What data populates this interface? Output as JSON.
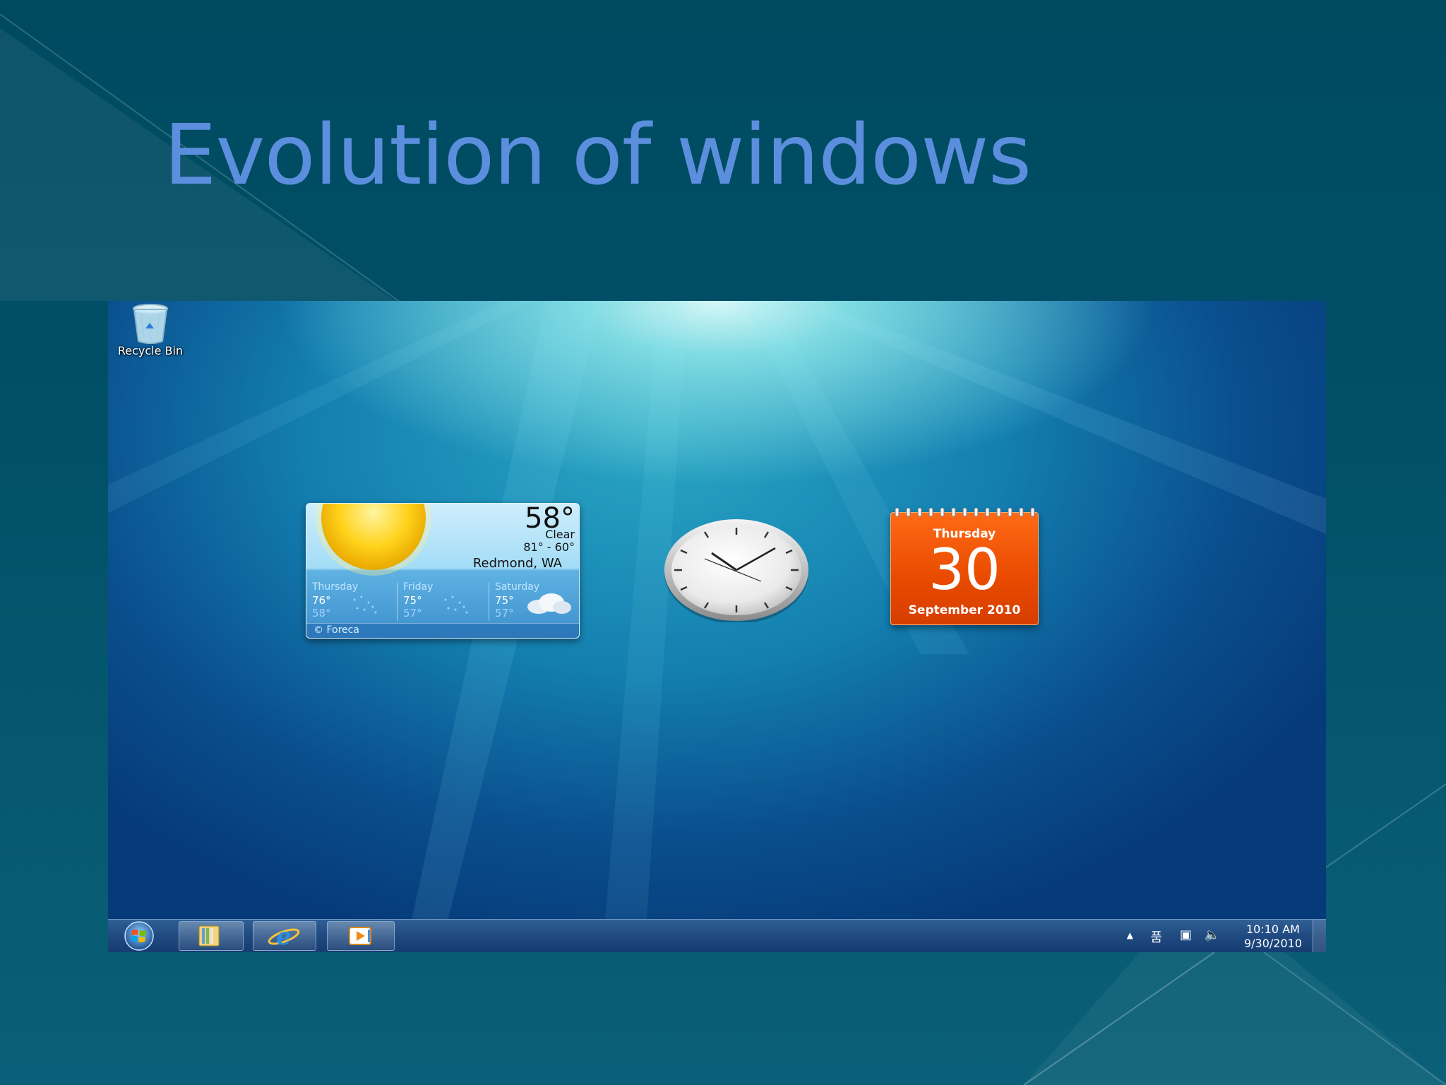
{
  "slide": {
    "title": "Evolution of windows"
  },
  "desktop": {
    "recycle_bin_label": "Recycle Bin"
  },
  "weather": {
    "temperature": "58°",
    "condition": "Clear",
    "range": "81° - 60°",
    "location": "Redmond, WA",
    "forecast": [
      {
        "day": "Thursday",
        "high": "76°",
        "low": "58°"
      },
      {
        "day": "Friday",
        "high": "75°",
        "low": "57°"
      },
      {
        "day": "Saturday",
        "high": "75°",
        "low": "57°"
      }
    ],
    "provider": "© Foreca"
  },
  "calendar": {
    "day_of_week": "Thursday",
    "day": "30",
    "month_year": "September 2010"
  },
  "taskbar": {
    "time": "10:10 AM",
    "date": "9/30/2010",
    "tray_icons": [
      "up-arrow-icon",
      "network-icon",
      "action-center-icon",
      "volume-icon"
    ],
    "pinned": [
      "windows-explorer-icon",
      "internet-explorer-icon",
      "media-player-icon"
    ]
  },
  "colors": {
    "title": "#5b8fde",
    "calendar": "#e84a00",
    "taskbar": "#1f4a80"
  }
}
